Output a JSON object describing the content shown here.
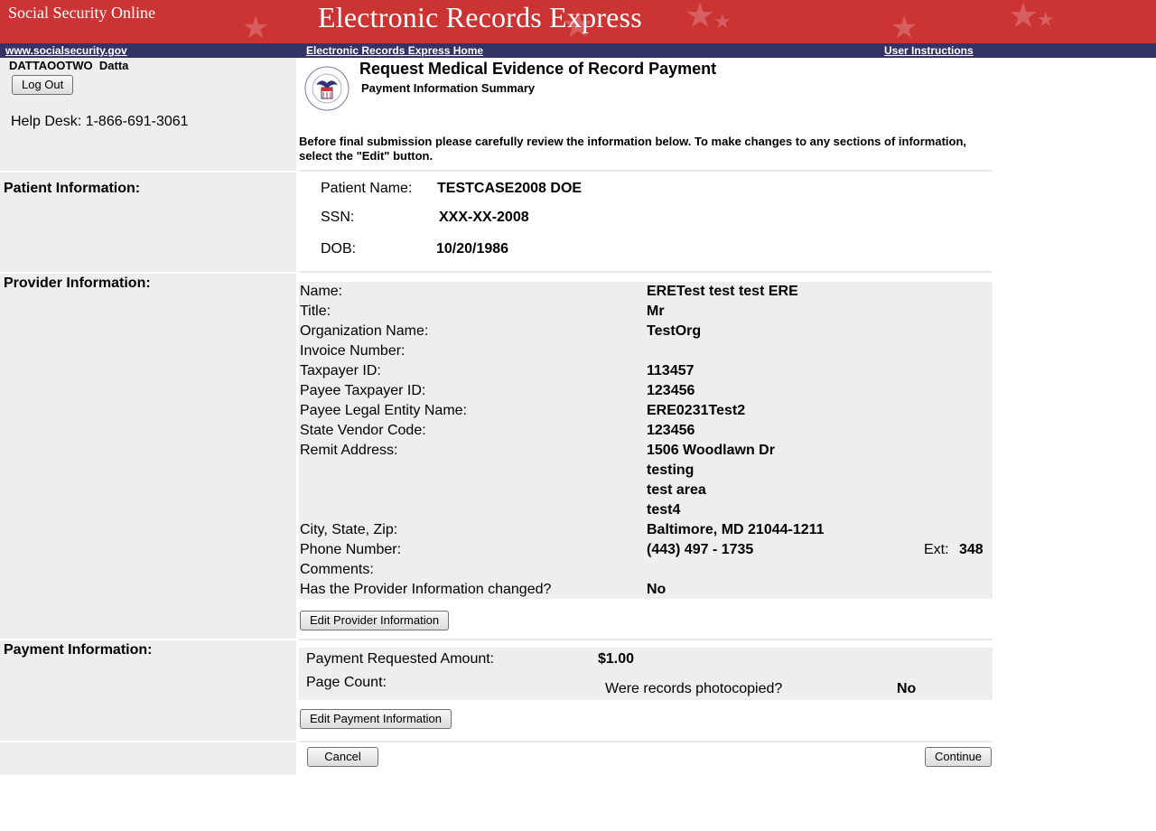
{
  "banner": {
    "site_name": "Social Security Online",
    "app_title": "Electronic Records Express",
    "bg_color": "#cc3333"
  },
  "nav": {
    "bg_color": "#333366",
    "links": [
      "www.socialsecurity.gov",
      "Electronic Records Express Home",
      "User Instructions"
    ]
  },
  "user": {
    "name": "DATTAOOTWO  Datta",
    "logout_label": "Log Out",
    "help_desk": "Help Desk: 1-866-691-3061"
  },
  "page": {
    "logo_icon": "ssa-seal-icon",
    "title": "Request Medical Evidence of Record Payment",
    "subtitle": "Payment Information Summary",
    "instructions": "Before final submission please carefully review the information below. To make changes to any sections of information, select the \"Edit\" button."
  },
  "patient": {
    "section_label": "Patient Information:",
    "name_label": "Patient Name:",
    "name_value": "TESTCASE2008 DOE",
    "ssn_label": "SSN:",
    "ssn_value": "XXX-XX-2008",
    "dob_label": "DOB:",
    "dob_value": "10/20/1986"
  },
  "provider": {
    "section_label": "Provider Information:",
    "rows": [
      {
        "label": "Name:",
        "value": "ERETest test test ERE"
      },
      {
        "label": "Title:",
        "value": "Mr"
      },
      {
        "label": "Organization Name:",
        "value": "TestOrg"
      },
      {
        "label": "Invoice Number:",
        "value": ""
      },
      {
        "label": "Taxpayer ID:",
        "value": "113457"
      },
      {
        "label": "Payee Taxpayer ID:",
        "value": "123456"
      },
      {
        "label": "Payee Legal Entity Name:",
        "value": "ERE0231Test2"
      },
      {
        "label": "State Vendor Code:",
        "value": "123456"
      },
      {
        "label": "Remit Address:",
        "value": "1506 Woodlawn Dr"
      },
      {
        "label": "",
        "value": "testing"
      },
      {
        "label": "",
        "value": "test area"
      },
      {
        "label": "",
        "value": "test4"
      },
      {
        "label": "City, State, Zip:",
        "value": "Baltimore, MD 21044-1211"
      },
      {
        "label": "Phone Number:",
        "value": "(443) 497 - 1735"
      },
      {
        "label": "Comments:",
        "value": ""
      },
      {
        "label": "Has the Provider Information changed?",
        "value": "No"
      }
    ],
    "ext_label": "Ext:",
    "ext_value": "348",
    "edit_label": "Edit Provider Information"
  },
  "payment": {
    "section_label": "Payment Information:",
    "amount_label": "Payment Requested Amount:",
    "amount_value": "$1.00",
    "page_count_label": "Page Count:",
    "photocopied_label": "Were records photocopied?",
    "photocopied_value": "No",
    "edit_label": "Edit Payment Information"
  },
  "actions": {
    "cancel_label": "Cancel",
    "continue_label": "Continue"
  }
}
